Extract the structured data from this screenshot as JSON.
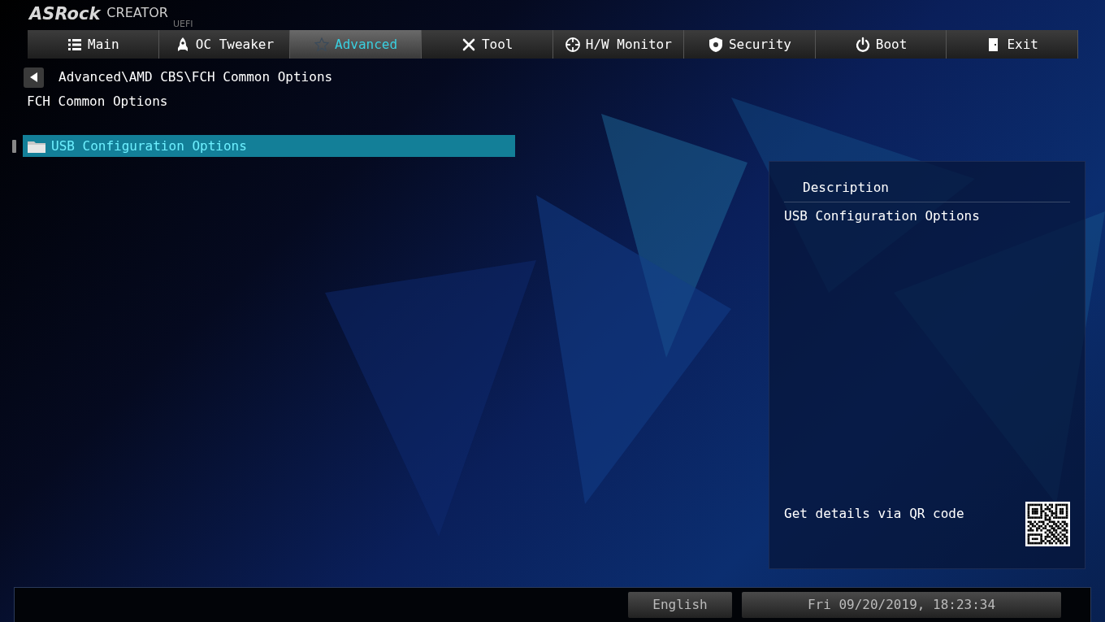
{
  "logo": {
    "brand": "ASRock",
    "product": "CREATOR",
    "subtitle": "UEFI"
  },
  "tabs": [
    {
      "label": "Main",
      "selected": false
    },
    {
      "label": "OC Tweaker",
      "selected": false
    },
    {
      "label": "Advanced",
      "selected": true
    },
    {
      "label": "Tool",
      "selected": false
    },
    {
      "label": "H/W Monitor",
      "selected": false
    },
    {
      "label": "Security",
      "selected": false
    },
    {
      "label": "Boot",
      "selected": false
    },
    {
      "label": "Exit",
      "selected": false
    }
  ],
  "breadcrumb": "Advanced\\AMD CBS\\FCH Common Options",
  "page_title": "FCH Common Options",
  "items": [
    {
      "label": "USB Configuration Options",
      "selected": true
    }
  ],
  "description": {
    "title": "Description",
    "text": "USB Configuration Options",
    "qr_hint": "Get details via QR code"
  },
  "status_bar": {
    "language": "English",
    "datetime": "Fri 09/20/2019, 18:23:34"
  }
}
